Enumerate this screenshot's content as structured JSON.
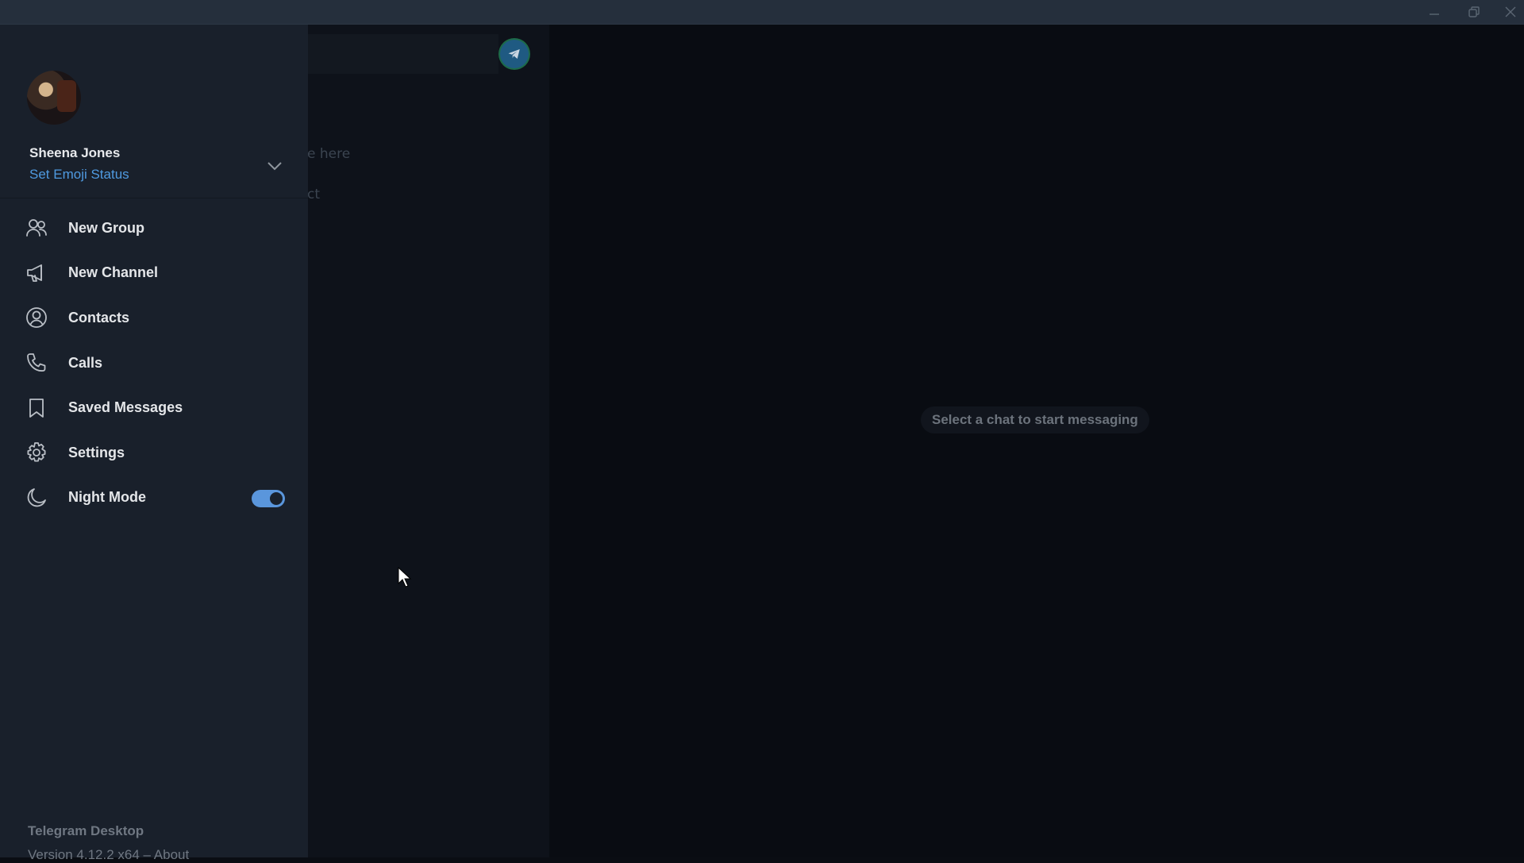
{
  "window": {
    "controls": [
      {
        "name": "minimize-icon"
      },
      {
        "name": "restore-icon"
      },
      {
        "name": "close-icon"
      }
    ]
  },
  "background": {
    "search_hint_fragment": "e here",
    "contact_fragment": "ct",
    "empty_state": "Select a chat to start messaging"
  },
  "profile": {
    "name": "Sheena Jones",
    "status_link": "Set Emoji Status"
  },
  "menu": {
    "items": [
      {
        "label": "New Group",
        "icon": "group-icon"
      },
      {
        "label": "New Channel",
        "icon": "megaphone-icon"
      },
      {
        "label": "Contacts",
        "icon": "contact-icon"
      },
      {
        "label": "Calls",
        "icon": "phone-icon"
      },
      {
        "label": "Saved Messages",
        "icon": "bookmark-icon"
      },
      {
        "label": "Settings",
        "icon": "gear-icon"
      },
      {
        "label": "Night Mode",
        "icon": "moon-icon",
        "toggle": true
      }
    ]
  },
  "night_mode_enabled": true,
  "footer": {
    "app_name": "Telegram Desktop",
    "version_line": "Version 4.12.2 x64 – About"
  },
  "colors": {
    "accent": "#5a96dc",
    "link": "#4f9ae0",
    "drawer_bg": "#19202b",
    "titlebar_bg": "#252f3c"
  }
}
